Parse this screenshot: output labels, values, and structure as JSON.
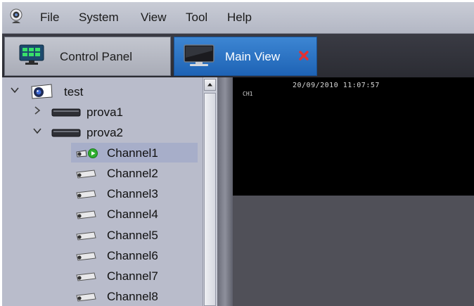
{
  "menu": {
    "items": [
      "File",
      "System",
      "View",
      "Tool",
      "Help"
    ]
  },
  "tabs": [
    {
      "label": "Control Panel",
      "active": false,
      "icon": "monitor-grid-icon"
    },
    {
      "label": "Main View",
      "active": true,
      "icon": "monitor-icon",
      "closable": true
    }
  ],
  "tree": {
    "root": {
      "label": "test",
      "expanded": true,
      "icon": "camera-icon"
    },
    "devices": [
      {
        "label": "prova1",
        "expanded": false,
        "icon": "dvr-icon"
      },
      {
        "label": "prova2",
        "expanded": true,
        "icon": "dvr-icon"
      }
    ],
    "channels": [
      {
        "label": "Channel1",
        "playing": true,
        "selected": true
      },
      {
        "label": "Channel2",
        "playing": false,
        "selected": false
      },
      {
        "label": "Channel3",
        "playing": false,
        "selected": false
      },
      {
        "label": "Channel4",
        "playing": false,
        "selected": false
      },
      {
        "label": "Channel5",
        "playing": false,
        "selected": false
      },
      {
        "label": "Channel6",
        "playing": false,
        "selected": false
      },
      {
        "label": "Channel7",
        "playing": false,
        "selected": false
      },
      {
        "label": "Channel8",
        "playing": false,
        "selected": false
      }
    ]
  },
  "video": {
    "timestamp": "20/09/2010 11:07:57",
    "channel_label": "CH1"
  },
  "colors": {
    "active_tab": "#2a70c2",
    "close_icon": "#e53030",
    "play_badge": "#2fae2f"
  }
}
